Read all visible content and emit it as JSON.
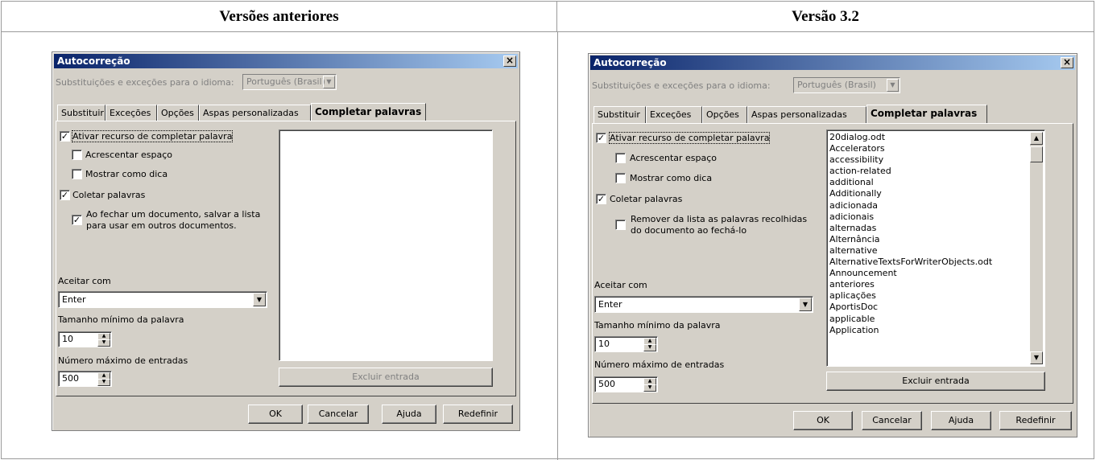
{
  "columns": {
    "left": "Versões anteriores",
    "right": "Versão 3.2"
  },
  "dialog": {
    "title": "Autocorreção",
    "close": "×",
    "language_label": "Substituições e exceções para o idioma:",
    "language_value": "Português (Brasil)",
    "tabs": [
      "Substituir",
      "Exceções",
      "Opções",
      "Aspas personalizadas",
      "Completar palavras"
    ],
    "enable": "Ativar recurso de completar palavra",
    "add_space": "Acrescentar espaço",
    "show_tip": "Mostrar como dica",
    "collect": "Coletar palavras",
    "save_list_line1": "Ao fechar um documento, salvar a lista",
    "save_list_line2": "para usar em outros documentos.",
    "remove_line1": "Remover da lista as palavras recolhidas",
    "remove_line2": "do documento ao fechá-lo",
    "accept_label": "Aceitar com",
    "accept_value": "Enter",
    "min_len_label": "Tamanho mínimo da palavra",
    "min_len_value": "10",
    "max_entries_label": "Número máximo de entradas",
    "max_entries_value": "500",
    "delete_entry": "Excluir entrada",
    "ok": "OK",
    "cancel": "Cancelar",
    "help": "Ajuda",
    "reset": "Redefinir",
    "words": [
      "20dialog.odt",
      "Accelerators",
      "accessibility",
      "action-related",
      "additional",
      "Additionally",
      "adicionada",
      "adicionais",
      "alternadas",
      "Alternância",
      "alternative",
      "AlternativeTextsForWriterObjects.odt",
      "Announcement",
      "anteriores",
      "aplicações",
      "AportisDoc",
      "applicable",
      "Application"
    ]
  }
}
